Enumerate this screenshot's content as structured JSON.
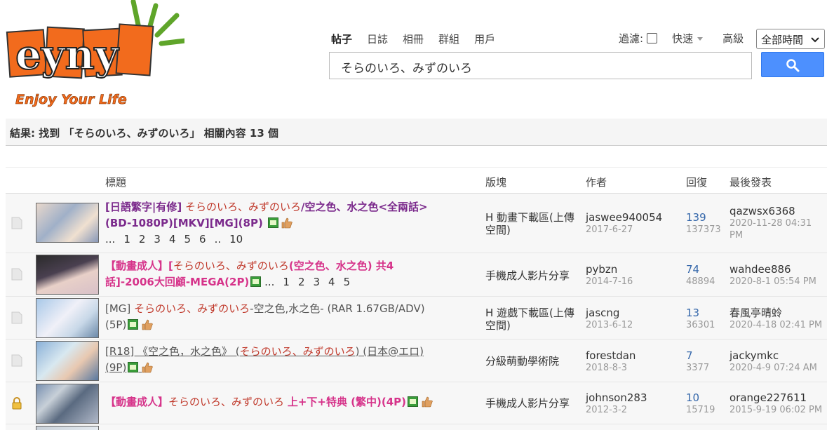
{
  "logo": {
    "wordmark": "eyny",
    "tagline": "Enjoy Your Life"
  },
  "nav": [
    {
      "label": "帖子",
      "active": true
    },
    {
      "label": "日誌",
      "active": false
    },
    {
      "label": "相冊",
      "active": false
    },
    {
      "label": "群組",
      "active": false
    },
    {
      "label": "用戶",
      "active": false
    }
  ],
  "filter": {
    "label": "過濾:",
    "quick_label": "快速",
    "advanced_label": "高級",
    "time_select": "全部時間"
  },
  "search": {
    "query": "そらのいろ、みずのいろ"
  },
  "result_summary": "結果: 找到 「そらのいろ、みずのいろ」 相關內容 13 個",
  "table": {
    "headers": {
      "title": "標題",
      "forum": "版塊",
      "author": "作者",
      "reply": "回復",
      "last": "最後發表"
    },
    "rows": [
      {
        "title_prefix": "[日語繁字|有修]",
        "title_highlight": "そらのいろ、みずのいろ",
        "title_rest": "/空之色、水之色<全兩話>",
        "title_line2": "(BD-1080P)[MKV][MG](8P)",
        "pages": [
          "...",
          "1",
          "2",
          "3",
          "4",
          "5",
          "6",
          "..",
          "10"
        ],
        "forum": "H 動畫下載區(上傳空間)",
        "author": "jaswee940054",
        "date": "2017-6-27",
        "replies": "139",
        "views": "137373",
        "last_user": "qazwsx6368",
        "last_date": "2020-11-28 04:31 PM"
      },
      {
        "title_prefix": "【動畫成人】[",
        "title_highlight": "そらのいろ、みずのいろ",
        "title_rest": "(空之色、水之色) 共4",
        "title_line2": "話]-2006大回顧-MEGA(2P)",
        "pages": [
          "...",
          "1",
          "2",
          "3",
          "4",
          "5"
        ],
        "forum": "手機成人影片分享",
        "author": "pybzn",
        "date": "2014-7-16",
        "replies": "74",
        "views": "48894",
        "last_user": "wahdee886",
        "last_date": "2020-8-1 05:54 PM"
      },
      {
        "title_prefix": "[MG]",
        "title_highlight": "そらのいろ、みずのいろ",
        "title_rest": "-空之色,水之色- (RAR 1.67GB/ADV)",
        "title_line2": "(5P)",
        "forum": "H 遊戲下載區(上傳空間)",
        "author": "jascng",
        "date": "2013-6-12",
        "replies": "13",
        "views": "36301",
        "last_user": "春風亭晴蛉",
        "last_date": "2020-4-18 02:41 PM"
      },
      {
        "title_prefix": "[R18] 《空之色，水之色》 (",
        "title_highlight": "そらのいろ、みずのいろ",
        "title_rest": ") (日本@エロ)",
        "title_line2": "(9P)",
        "forum": "分級萌動學術院",
        "author": "forestdan",
        "date": "2018-8-3",
        "replies": "7",
        "views": "3377",
        "last_user": "jackymkc",
        "last_date": "2020-4-9 07:24 AM"
      },
      {
        "title_prefix": "【動畫成人】",
        "title_highlight": "そらのいろ、みずのいろ",
        "title_rest": "上+下+特典 (繁中)(4P)",
        "forum": "手機成人影片分享",
        "author": "johnson283",
        "date": "2012-3-2",
        "replies": "10",
        "views": "15719",
        "last_user": "orange227611",
        "last_date": "2015-9-19 06:02 PM"
      }
    ]
  },
  "colors": {
    "accent": "#4d90fe",
    "logo_orange": "#f26b1d",
    "highlight": "#c0392b",
    "purple_title": "#7b2a8c",
    "pink_title": "#d6338a",
    "reply_blue": "#3366aa"
  }
}
